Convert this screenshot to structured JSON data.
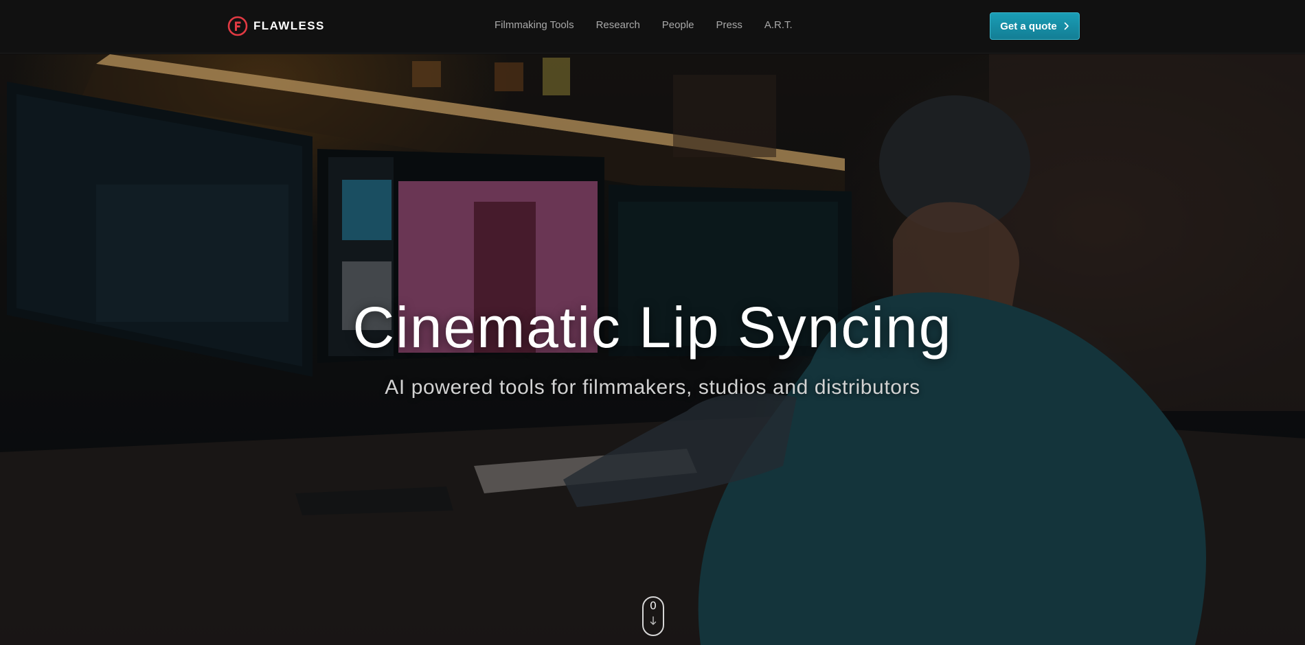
{
  "brand": {
    "name": "FLAWLESS",
    "logo_icon": "flawless-f-logo-icon",
    "accent_color": "#e23a43"
  },
  "nav": {
    "links": [
      {
        "label": "Filmmaking Tools"
      },
      {
        "label": "Research"
      },
      {
        "label": "People"
      },
      {
        "label": "Press"
      },
      {
        "label": "A.R.T."
      }
    ]
  },
  "cta": {
    "label": "Get a quote",
    "icon": "chevron-right-icon",
    "color": "#1791a8"
  },
  "hero": {
    "title": "Cinematic Lip Syncing",
    "subtitle": "AI powered tools for filmmakers, studios and distributors",
    "background_image": "editor working at a three-monitor desk in a dark studio"
  },
  "scroll_indicator": {
    "count": "0",
    "icon": "arrow-down-icon"
  }
}
